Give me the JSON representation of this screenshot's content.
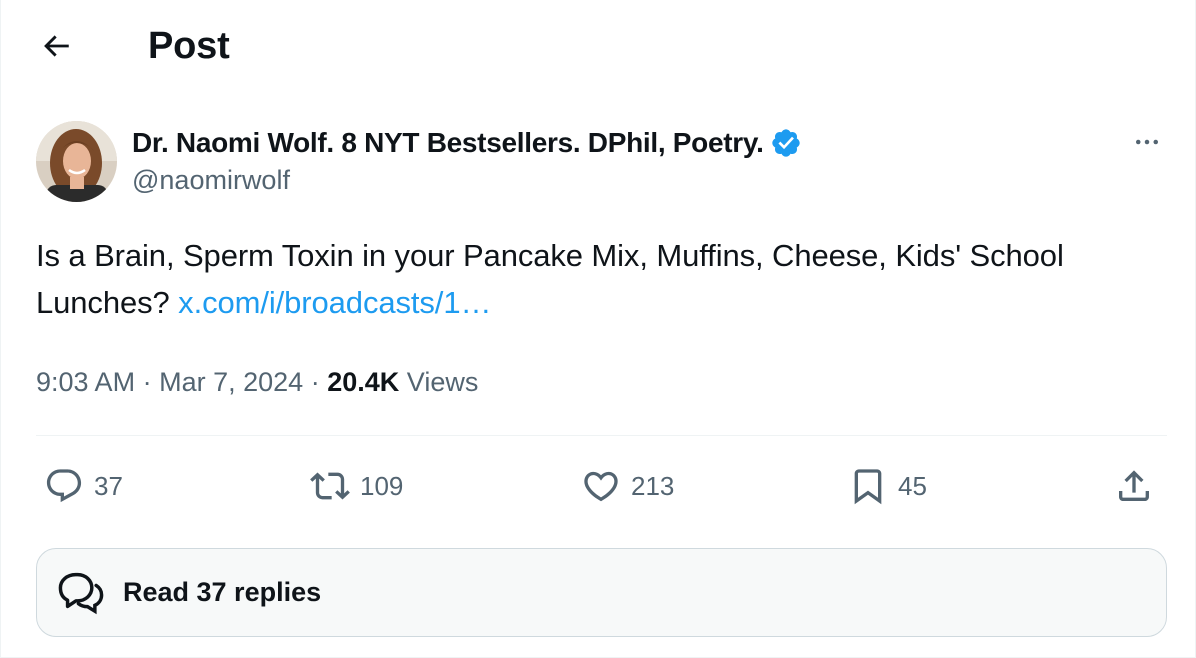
{
  "header": {
    "title": "Post",
    "back_icon": "arrow-left-icon"
  },
  "author": {
    "display_name": "Dr. Naomi Wolf. 8 NYT Bestsellers. DPhil, Poetry.",
    "handle": "@naomirwolf",
    "verified": true,
    "verified_color": "#1d9bf0"
  },
  "post": {
    "text": "Is a Brain, Sperm Toxin in your Pancake Mix, Muffins, Cheese, Kids' School Lunches? ",
    "link_text": "x.com/i/broadcasts/1…",
    "link_color": "#1d9bf0"
  },
  "meta": {
    "time": "9:03 AM",
    "separator": "·",
    "date": "Mar 7, 2024",
    "views_count": "20.4K",
    "views_label": "Views"
  },
  "actions": {
    "replies": "37",
    "reposts": "109",
    "likes": "213",
    "bookmarks": "45"
  },
  "read_replies": {
    "label": "Read 37 replies"
  },
  "colors": {
    "text_primary": "#0f1419",
    "text_secondary": "#536471",
    "accent": "#1d9bf0",
    "border": "#cfd9de"
  }
}
